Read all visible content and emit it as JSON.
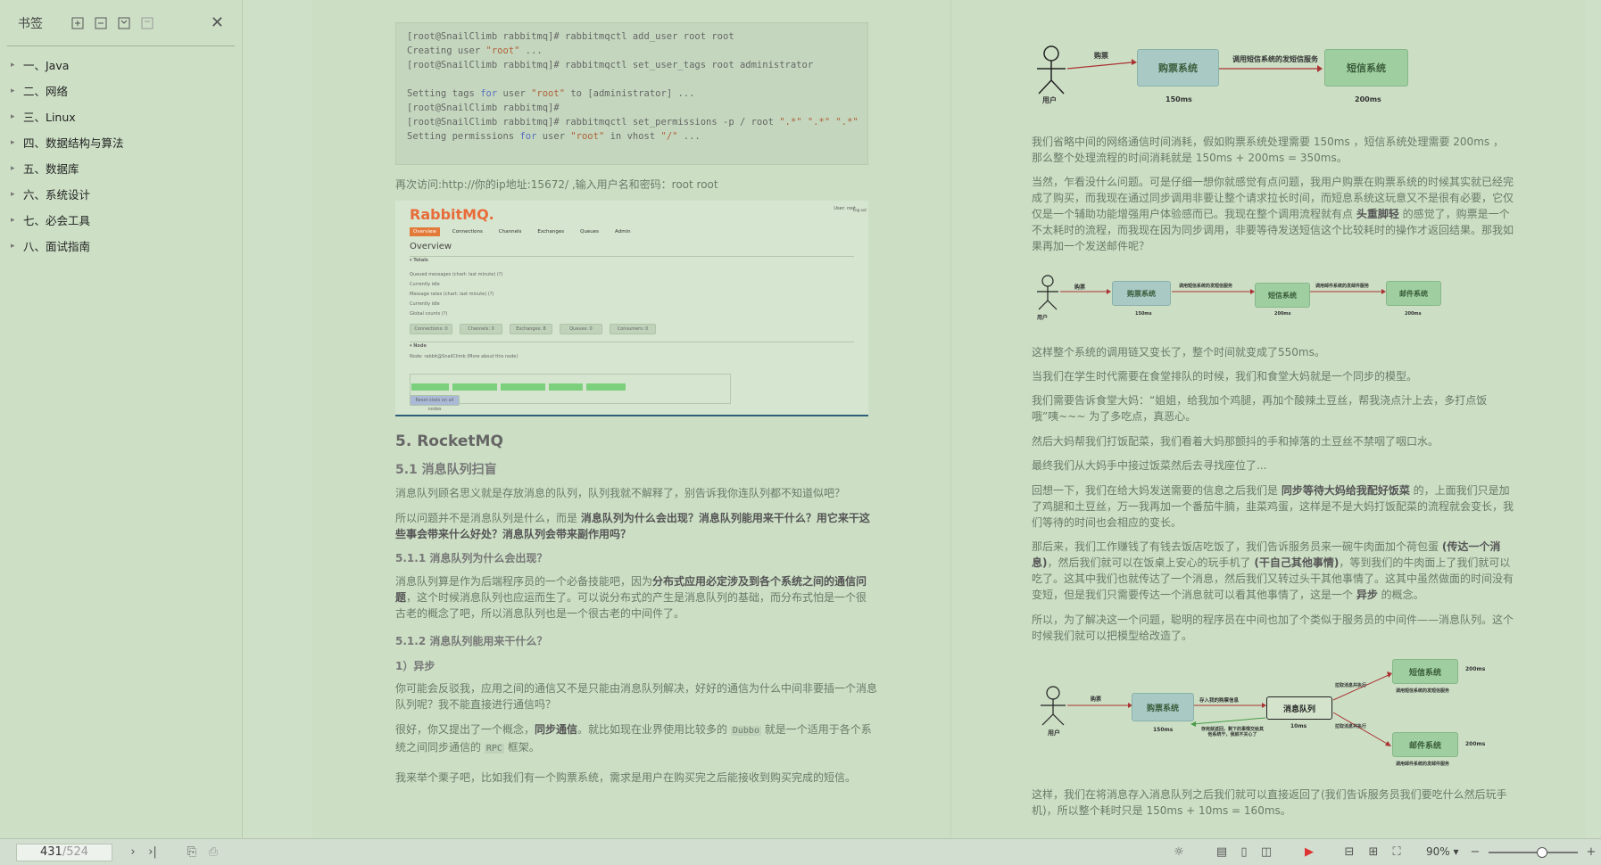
{
  "sidebar": {
    "title": "书签",
    "items": [
      {
        "label": "一、Java"
      },
      {
        "label": "二、网络"
      },
      {
        "label": "三、Linux"
      },
      {
        "label": "四、数据结构与算法"
      },
      {
        "label": "五、数据库"
      },
      {
        "label": "六、系统设计"
      },
      {
        "label": "七、必会工具"
      },
      {
        "label": "八、面试指南"
      }
    ]
  },
  "left_page": {
    "code_lines": [
      [
        "[root@SnailClimb rabbitmq]# rabbitmqctl add_user root root"
      ],
      [
        "Creating user ",
        "\"root\"",
        " ..."
      ],
      [
        "[root@SnailClimb rabbitmq]# rabbitmqctl set_user_tags root administrator"
      ],
      [
        ""
      ],
      [
        "Setting tags ",
        "for",
        " user ",
        "\"root\"",
        " to [administrator] ..."
      ],
      [
        "[root@SnailClimb rabbitmq]#"
      ],
      [
        "[root@SnailClimb rabbitmq]# rabbitmqctl set_permissions -p / root ",
        "\".*\"",
        " ",
        "\".*\"",
        " ",
        "\".*\""
      ],
      [
        "Setting permissions ",
        "for",
        " user ",
        "\"root\"",
        " in vhost ",
        "\"/\"",
        " ..."
      ]
    ],
    "visit_text": "再次访问:http://你的ip地址:15672/ ,输入用户名和密码：root root",
    "rabbit": {
      "logo": "RabbitMQ.",
      "tabs": [
        "Overview",
        "Connections",
        "Channels",
        "Exchanges",
        "Queues",
        "Admin"
      ],
      "overview": "Overview",
      "totals": "▾ Totals",
      "queued": "Queued messages (chart: last minute) (?)",
      "currently_idle": "Currently idle",
      "message_rates": "Message rates (chart: last minute) (?)",
      "global_counts": "Global counts (?)",
      "counts": [
        "Connections: 0",
        "Channels: 0",
        "Exchanges: 8",
        "Queues: 0",
        "Consumers: 0"
      ],
      "node": "▾ Node",
      "node_name": "Node: rabbit@SnailClimb (More about this node)",
      "reset": "Reset stats on all nodes",
      "user": "User: root",
      "logout": "Log out"
    },
    "h2": "5. RocketMQ",
    "h3_1": "5.1 消息队列扫盲",
    "p1": "消息队列顾名思义就是存放消息的队列，队列我就不解释了，别告诉我你连队列都不知道似吧？",
    "p2_a": "所以问题并不是消息队列是什么，而是 ",
    "p2_b": "消息队列为什么会出现？消息队列能用来干什么？用它来干这些事会带来什么好处？消息队列会带来副作用吗？",
    "h4_1": "5.1.1 消息队列为什么会出现？",
    "p3_a": "消息队列算是作为后端程序员的一个必备技能吧，因为",
    "p3_b": "分布式应用必定涉及到各个系统之间的通信问题",
    "p3_c": "，这个时候消息队列也应运而生了。可以说分布式的产生是消息队列的基础，而分布式怕是一个很古老的概念了吧，所以消息队列也是一个很古老的中间件了。",
    "h4_2": "5.1.2 消息队列能用来干什么？",
    "h4_3": "1）异步",
    "p4": "你可能会反驳我，应用之间的通信又不是只能由消息队列解决，好好的通信为什么中间非要插一个消息队列呢？我不能直接进行通信吗？",
    "p5_a": "很好，你又提出了一个概念，",
    "p5_b": "同步通信",
    "p5_c": "。就比如现在业界使用比较多的 ",
    "p5_d": "Dubbo",
    "p5_e": " 就是一个适用于各个系统之间同步通信的 ",
    "p5_f": "RPC",
    "p5_g": " 框架。",
    "p6": "我来举个栗子吧，比如我们有一个购票系统，需求是用户在购买完之后能接收到购买完成的短信。"
  },
  "right_page": {
    "d1": {
      "user": "用户",
      "buy": "购票",
      "sys1": "购票系统",
      "call": "调用短信系统的发短信服务",
      "sys2": "短信系统",
      "t1": "150ms",
      "t2": "200ms"
    },
    "p1": "我们省略中间的网络通信时间消耗，假如购票系统处理需要 150ms ，短信系统处理需要 200ms ，那么整个处理流程的时间消耗就是 150ms + 200ms = 350ms。",
    "p2_a": "当然，乍看没什么问题。可是仔细一想你就感觉有点问题，我用户购票在购票系统的时候其实就已经完成了购买，而我现在通过同步调用非要让整个请求拉长时间，而短息系统这玩意又不是很有必要，它仅仅是一个辅助功能增强用户体验感而已。我现在整个调用流程就有点 ",
    "p2_b": "头重脚轻",
    "p2_c": " 的感觉了，购票是一个不太耗时的流程，而我现在因为同步调用，非要等待发送短信这个比较耗时的操作才返回结果。那我如果再加一个发送邮件呢？",
    "d2": {
      "user": "用户",
      "buy": "购票",
      "sys1": "购票系统",
      "call1": "调用短信系统的发短信服务",
      "sys2": "短信系统",
      "call2": "调用邮件系统的发邮件服务",
      "sys3": "邮件系统",
      "t1": "150ms",
      "t2": "200ms",
      "t3": "200ms"
    },
    "p3": "这样整个系统的调用链又变长了，整个时间就变成了550ms。",
    "p4": "当我们在学生时代需要在食堂排队的时候，我们和食堂大妈就是一个同步的模型。",
    "p5": "我们需要告诉食堂大妈：“姐姐，给我加个鸡腿，再加个酸辣土豆丝，帮我浇点汁上去，多打点饭哦”咦~~~ 为了多吃点，真恶心。",
    "p6": "然后大妈帮我们打饭配菜，我们看着大妈那颤抖的手和掉落的土豆丝不禁咽了咽口水。",
    "p7": "最终我们从大妈手中接过饭菜然后去寻找座位了...",
    "p8_a": "回想一下，我们在给大妈发送需要的信息之后我们是 ",
    "p8_b": "同步等待大妈给我配好饭菜",
    "p8_c": " 的，上面我们只是加了鸡腿和土豆丝，万一我再加一个番茄牛腩，韭菜鸡蛋，这样是不是大妈打饭配菜的流程就会变长，我们等待的时间也会相应的变长。",
    "p9_a": "那后来，我们工作赚钱了有钱去饭店吃饭了，我们告诉服务员来一碗牛肉面加个荷包蛋 ",
    "p9_b": "(传达一个消息)",
    "p9_c": "，然后我们就可以在饭桌上安心的玩手机了 ",
    "p9_d": "(干自己其他事情)",
    "p9_e": "，等到我们的牛肉面上了我们就可以吃了。这其中我们也就传达了一个消息，然后我们又转过头干其他事情了。这其中虽然做面的时间没有变短，但是我们只需要传达一个消息就可以看其他事情了，这是一个 ",
    "p9_f": "异步",
    "p9_g": " 的概念。",
    "p10": "所以，为了解决这一个问题，聪明的程序员在中间也加了个类似于服务员的中间件——消息队列。这个时候我们就可以把模型给改造了。",
    "d3": {
      "user": "用户",
      "buy": "购票",
      "sys1": "购票系统",
      "put": "存入我的购票信息",
      "mq": "消息队列",
      "ret": "存完就返回，剩下的事情交给其他系统干，我就不关心了",
      "pull1": "拉取消息并执行",
      "pull2": "拉取消息并执行",
      "sms": "短信系统",
      "sms_sub": "调用短信系统的发短信服务",
      "mail": "邮件系统",
      "mail_sub": "调用邮件系统的发邮件服务",
      "t1": "150ms",
      "t2": "10ms",
      "t3": "200ms",
      "t4": "200ms"
    },
    "p11": "这样，我们在将消息存入消息队列之后我们就可以直接返回了(我们告诉服务员我们要吃什么然后玩手机)，所以整个耗时只是 150ms + 10ms = 160ms。"
  },
  "bottom": {
    "current_page": "431",
    "total_pages": "/524",
    "zoom": "90%"
  },
  "colors": {
    "eye_care_bg": "#cfe0c8",
    "box_green": "#9fcfa0",
    "arrow_red": "#c0392b"
  }
}
